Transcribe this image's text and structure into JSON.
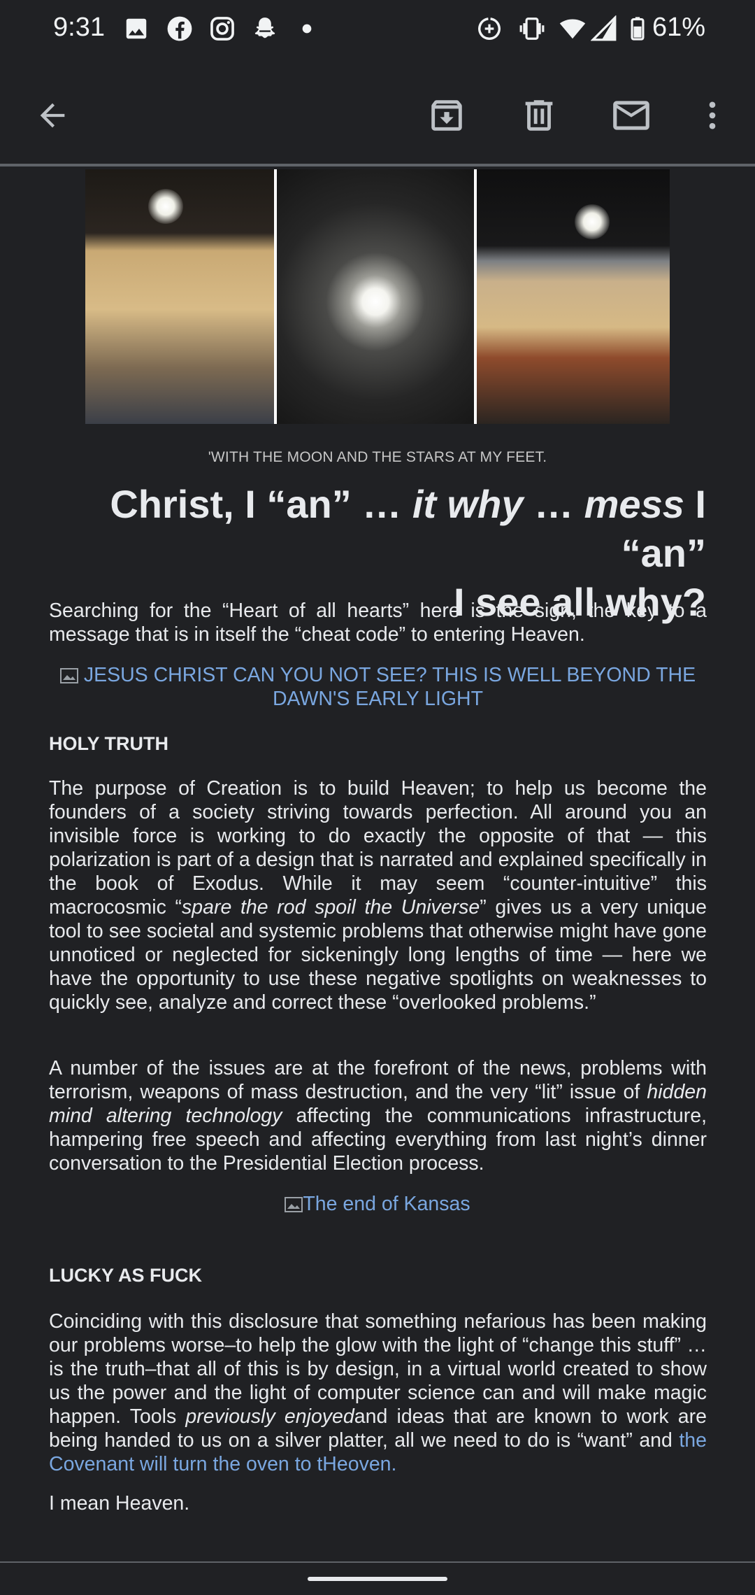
{
  "status_bar": {
    "time": "9:31",
    "battery": "61%",
    "left_icons": [
      "photo-icon",
      "facebook-icon",
      "instagram-icon",
      "snapchat-icon",
      "dot-icon"
    ],
    "right_icons": [
      "data-saver-icon",
      "vibrate-icon",
      "wifi-icon",
      "signal-icon",
      "battery-icon"
    ]
  },
  "toolbar": {
    "icons": [
      "back-arrow-icon",
      "archive-icon",
      "delete-icon",
      "mark-unread-icon",
      "more-vert-icon"
    ]
  },
  "email": {
    "caption": "'WITH THE MOON AND THE STARS AT MY FEET.",
    "headline": {
      "part1": "Christ, I “an” … ",
      "italic1": "it why",
      "part2": " … ",
      "italic2": "mess",
      "part3": " I “an”",
      "line2": "I see all why?"
    },
    "intro": "Searching for the “Heart of all hearts” here is the sign, the key to a message that is in itself the “cheat code” to entering Heaven.",
    "image_link_1": "JESUS CHRIST CAN YOU NOT SEE? THIS IS WELL BEYOND THE DAWN'S EARLY LIGHT",
    "section1_heading": "HOLY TRUTH",
    "section1_p1": {
      "before": "The purpose of Creation is to build Heaven; to help us become the founders of a society striving towards perfection. All around you an invisible force is working to do exactly the opposite of that — this polarization is part of a design that is narrated and explained specifically in the book of Exodus. While it may seem “counter-intuitive” this macrocosmic “",
      "italic": "spare the rod spoil the Universe",
      "after": "” gives us a very unique tool to see societal and systemic problems that otherwise might have gone unnoticed or neglected for sickeningly long lengths of time — here we have the opportunity to use these negative spotlights on weaknesses to quickly see, analyze and correct these “overlooked problems.”"
    },
    "section1_p2": {
      "before": "A number of the issues are at the forefront of the news, problems with terrorism, weapons of mass destruction, and the very “lit” issue of ",
      "italic": "hidden mind altering technology",
      "after": " affecting the communications infrastructure, hampering free speech and affecting everything from last night’s dinner conversation to the Presidential Election process."
    },
    "image_link_2": "The end of Kansas",
    "section2_heading": "LUCKY AS FUCK",
    "section2_p1": {
      "before": "Coinciding with this disclosure that something nefarious has been making our problems worse–to help the glow with the light of “change this stuff” … is the truth–that all of this is by design, in a virtual world created to show us the power and the light of computer science can and will make magic happen. Tools ",
      "italic": "previously enjoyed",
      "middle": "and ideas that are known to work are being handed to us on a silver platter, all we need to do is “want” and ",
      "link": "the Covenant will turn the oven to tHeoven."
    },
    "closing": "I mean Heaven."
  },
  "colors": {
    "background": "#202124",
    "text": "#e8eaed",
    "link": "#7aa7e0",
    "divider": "#5f6368"
  }
}
